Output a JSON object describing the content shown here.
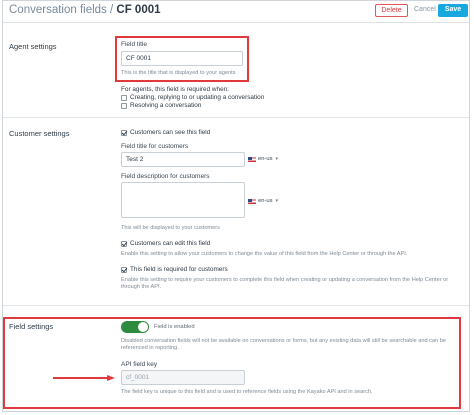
{
  "header": {
    "breadcrumb_link": "Conversation fields",
    "breadcrumb_sep": " / ",
    "breadcrumb_current": "CF 0001",
    "delete_label": "Delete",
    "cancel_label": "Cancel",
    "save_label": "Save"
  },
  "agent": {
    "section_label": "Agent settings",
    "field_title_label": "Field title",
    "field_title_value": "CF 0001",
    "field_title_help": "This is the title that is displayed to your agents",
    "required_label": "For agents, this field is required when:",
    "opt_replying": "Creating, replying to or updating a conversation",
    "opt_resolving": "Resolving a conversation"
  },
  "customer": {
    "section_label": "Customer settings",
    "can_see_label": "Customers can see this field",
    "title_label": "Field title for customers",
    "title_value": "Test 2",
    "locale": "en-us",
    "desc_label": "Field description for customers",
    "desc_help": "This will be displayed to your customers",
    "can_edit_label": "Customers can edit this field",
    "can_edit_help": "Enable this setting to allow your customers to change the value of this field from the Help Center or through the API.",
    "required_label": "This field is required for customers",
    "required_help": "Enable this setting to require your customers to complete this field when creating or updating a conversation from the Help Center or through the API."
  },
  "field": {
    "section_label": "Field settings",
    "enabled_label": "Field is enabled",
    "disabled_help": "Disabled conversation fields will not be available on conversations or forms, but any existing data will still be searchable and can be referenced in reporting.",
    "api_key_label": "API field key",
    "api_key_value": "cf_0001",
    "api_key_help": "The field key is unique to this field and is used to reference fields using the Kayako API and in search."
  },
  "colors": {
    "accent": "#16a8de",
    "danger": "#e03a3f",
    "toggle_on": "#2d8a3e"
  }
}
